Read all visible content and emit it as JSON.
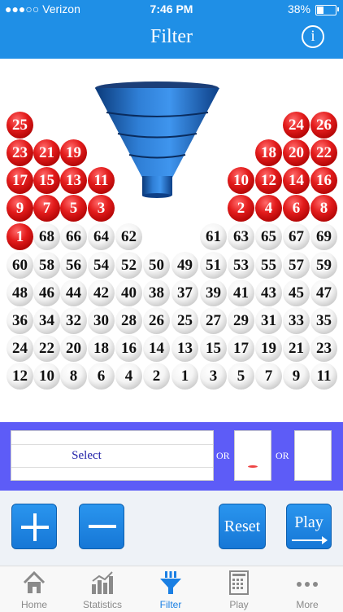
{
  "status_bar": {
    "carrier": "●●●○○ Verizon",
    "time": "7:46 PM",
    "battery": "38%"
  },
  "nav": {
    "title": "Filter",
    "info_icon": "info-icon"
  },
  "funnel": {
    "icon": "funnel-icon",
    "color": "#1a5fb4"
  },
  "selected_numbers": [
    "25",
    "24",
    "26",
    "23",
    "21",
    "19",
    "18",
    "20",
    "22",
    "17",
    "15",
    "13",
    "11",
    "10",
    "12",
    "14",
    "16",
    "9",
    "7",
    "5",
    "3",
    "2",
    "4",
    "6",
    "8",
    "1"
  ],
  "pool_numbers": [
    "68",
    "66",
    "64",
    "62",
    "61",
    "63",
    "65",
    "67",
    "69",
    "60",
    "58",
    "56",
    "54",
    "52",
    "50",
    "49",
    "51",
    "53",
    "55",
    "57",
    "59",
    "48",
    "46",
    "44",
    "42",
    "40",
    "38",
    "37",
    "39",
    "41",
    "43",
    "45",
    "47",
    "36",
    "34",
    "32",
    "30",
    "28",
    "26",
    "25",
    "27",
    "29",
    "31",
    "33",
    "35",
    "24",
    "22",
    "20",
    "18",
    "16",
    "14",
    "13",
    "15",
    "17",
    "19",
    "21",
    "23",
    "12",
    "10",
    "8",
    "6",
    "4",
    "2",
    "1",
    "3",
    "5",
    "7",
    "9",
    "11"
  ],
  "filter_panel": {
    "select_label": "Select",
    "or_1": "OR",
    "or_2": "OR"
  },
  "buttons": {
    "reset": "Reset",
    "play": "Play"
  },
  "tabs": [
    {
      "label": "Home",
      "icon": "home-icon"
    },
    {
      "label": "Statistics",
      "icon": "bar-chart-icon"
    },
    {
      "label": "Filter",
      "icon": "filter-icon",
      "active": true
    },
    {
      "label": "Play",
      "icon": "lotto-ticket-icon"
    },
    {
      "label": "More",
      "icon": "more-icon"
    }
  ],
  "colors": {
    "accent": "#1f8fe6",
    "panel": "#5d5cf7",
    "red_ball": "#e31c1c",
    "active_tab": "#1a7fe3"
  }
}
